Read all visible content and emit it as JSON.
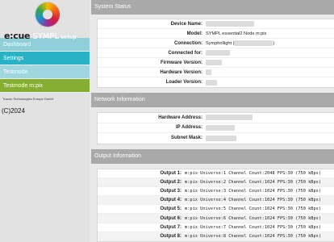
{
  "brand": {
    "strong": "e:cue",
    "light": " SYMPL",
    "small": " setup"
  },
  "nav": {
    "items": [
      {
        "label": "Dashboard"
      },
      {
        "label": "Settings"
      },
      {
        "label": "Testmode"
      },
      {
        "label": "Testmode m:pix"
      }
    ]
  },
  "company": "Traxon Technologies Europe GmbH",
  "copyright": "(C)2024",
  "system_status": {
    "title": "System Status",
    "rows": [
      {
        "label": "Device Name:",
        "value": ""
      },
      {
        "label": "Model:",
        "value": "SYMPL essential2 Node m:pix"
      },
      {
        "label": "Connection:",
        "prefix": "Symphollight (",
        "suffix": ")"
      },
      {
        "label": "Connected for:",
        "value": ""
      },
      {
        "label": "Firmware Version:",
        "value": ""
      },
      {
        "label": "Hardware Version:",
        "value": ""
      },
      {
        "label": "Loader Version:",
        "value": ""
      }
    ]
  },
  "network": {
    "title": "Network Information",
    "rows": [
      {
        "label": "Hardware Address:",
        "value": ""
      },
      {
        "label": "IP Address:",
        "value": ""
      },
      {
        "label": "Subnet Mask:",
        "value": ""
      }
    ]
  },
  "output": {
    "title": "Output Information",
    "rows": [
      {
        "label": "Output 1:",
        "value": "m:pix Universe:1 Channel Count:2048 FPS:30 (750 kBps)"
      },
      {
        "label": "Output 2:",
        "value": "m:pix Universe:2 Channel Count:1024 FPS:30 (750 kBps)"
      },
      {
        "label": "Output 3:",
        "value": "m:pix Universe:3 Channel Count:1024 FPS:30 (750 kBps)"
      },
      {
        "label": "Output 4:",
        "value": "m:pix Universe:4 Channel Count:1024 FPS:30 (750 kBps)"
      },
      {
        "label": "Output 5:",
        "value": "m:pix Universe:5 Channel Count:1024 FPS:30 (750 kBps)"
      },
      {
        "label": "Output 6:",
        "value": "m:pix Universe:6 Channel Count:1024 FPS:30 (750 kBps)"
      },
      {
        "label": "Output 7:",
        "value": "m:pix Universe:7 Channel Count:1024 FPS:30 (750 kBps)"
      },
      {
        "label": "Output 8:",
        "value": "m:pix Universe:8 Channel Count:1024 FPS:30 (750 kBps)"
      }
    ]
  },
  "colors": {
    "nav_dashboard": "#8fcfd9",
    "nav_settings": "#29b2c6",
    "nav_testmode": "#9fd6e0",
    "nav_testmode_mpix": "#86ae33",
    "section_header": "#a9a9a9"
  }
}
